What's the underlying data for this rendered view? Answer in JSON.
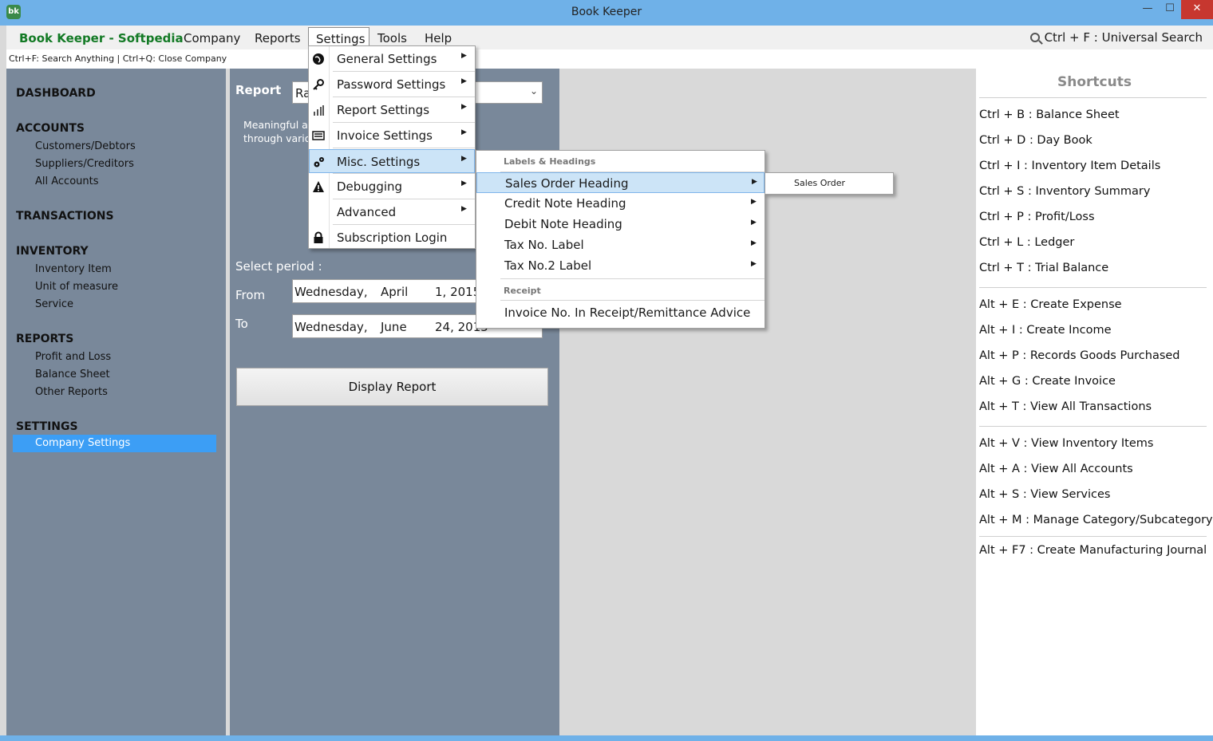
{
  "window": {
    "title": "Book Keeper",
    "minimize": "—",
    "maximize": "☐",
    "close": "✕",
    "logo_text": "bk"
  },
  "menubar": {
    "brand": "Book Keeper - Softpedia",
    "menus": [
      "Company",
      "Reports",
      "Settings",
      "Tools",
      "Help"
    ],
    "universal_search": "Ctrl + F  : Universal Search"
  },
  "hintbar": {
    "text": "Ctrl+F: Search Anything | Ctrl+Q: Close Company"
  },
  "sidebar": {
    "dashboard": "DASHBOARD",
    "accounts": {
      "title": "ACCOUNTS",
      "items": [
        "Customers/Debtors",
        "Suppliers/Creditors",
        "All Accounts"
      ]
    },
    "transactions": "TRANSACTIONS",
    "inventory": {
      "title": "INVENTORY",
      "items": [
        "Inventory Item",
        "Unit of measure",
        "Service"
      ]
    },
    "reports": {
      "title": "REPORTS",
      "items": [
        "Profit and Loss",
        "Balance Sheet",
        "Other Reports"
      ]
    },
    "settings": {
      "title": "SETTINGS",
      "items": [
        "Company Settings"
      ]
    }
  },
  "report_panel": {
    "report_label": "Report",
    "report_value": "Ra",
    "description_line1": "Meaningful ar",
    "description_line2": "through vario",
    "select_period": "Select period :",
    "from_label": "From",
    "from_day": "Wednesday,",
    "from_month": "April",
    "from_date": "1, 2015",
    "to_label": "To",
    "to_day": "Wednesday,",
    "to_month": "June",
    "to_date": "24, 2015",
    "display_button": "Display Report"
  },
  "shortcuts": {
    "title": "Shortcuts",
    "group1": [
      "Ctrl + B : Balance Sheet",
      "Ctrl + D : Day Book",
      "Ctrl + I  : Inventory Item Details",
      "Ctrl + S : Inventory Summary",
      "Ctrl + P : Profit/Loss",
      "Ctrl + L : Ledger",
      "Ctrl + T : Trial Balance"
    ],
    "group2": [
      "Alt + E : Create Expense",
      "Alt + I  : Create Income",
      "Alt + P : Records Goods Purchased",
      "Alt + G : Create Invoice",
      "Alt + T : View All Transactions"
    ],
    "group3": [
      "Alt + V : View Inventory Items",
      "Alt + A : View All Accounts",
      "Alt + S : View Services",
      "Alt + M : Manage Category/Subcategory"
    ],
    "group4": [
      "Alt + F7 : Create Manufacturing Journal"
    ]
  },
  "settings_menu": {
    "items": [
      "General Settings",
      "Password Settings",
      "Report Settings",
      "Invoice Settings",
      "Misc. Settings",
      "Debugging",
      "Advanced",
      "Subscription Login"
    ],
    "highlighted": "Misc. Settings"
  },
  "misc_submenu": {
    "group1_header": "Labels & Headings",
    "group1_items": [
      "Sales Order Heading",
      "Credit Note Heading",
      "Debit Note Heading",
      "Tax No. Label",
      "Tax No.2 Label"
    ],
    "group2_header": "Receipt",
    "group2_items": [
      "Invoice No. In Receipt/Remittance Advice"
    ],
    "highlighted": "Sales Order Heading"
  },
  "sales_order_submenu": {
    "value": "Sales Order"
  },
  "colors": {
    "titlebar": "#6fb1e8",
    "panel": "#79889a",
    "selection": "#3c9ef5",
    "brand_green": "#137a25",
    "menu_highlight": "#cce4f7"
  }
}
